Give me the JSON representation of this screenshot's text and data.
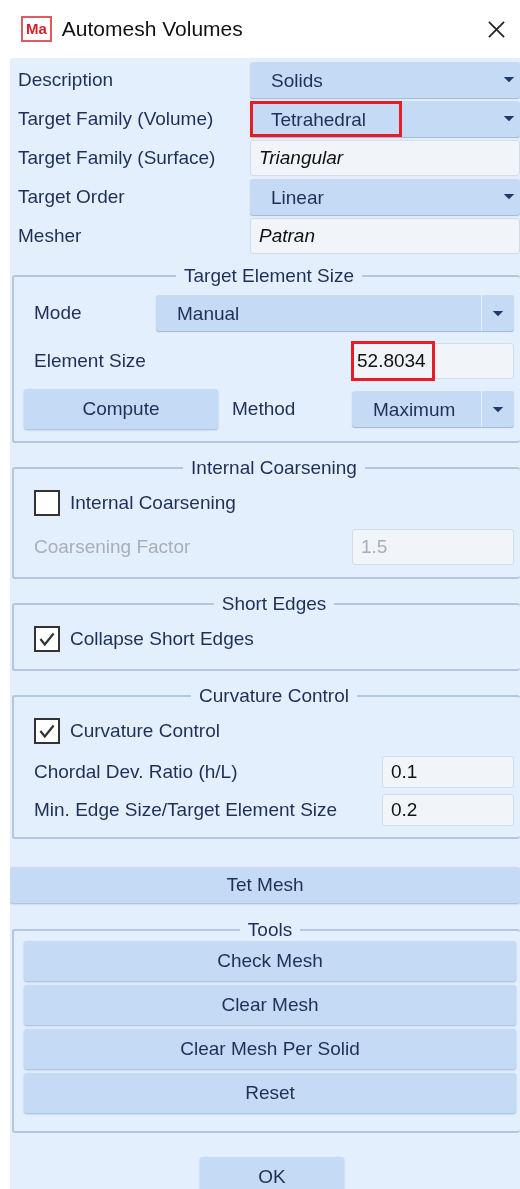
{
  "window": {
    "logo": "Ma",
    "title": "Automesh Volumes"
  },
  "properties": [
    {
      "label": "Description",
      "kind": "combo",
      "value": "Solids",
      "highlighted": false
    },
    {
      "label": "Target Family (Volume)",
      "kind": "combo",
      "value": "Tetrahedral",
      "highlighted": true
    },
    {
      "label": "Target Family (Surface)",
      "kind": "text",
      "value": "Triangular",
      "highlighted": false
    },
    {
      "label": "Target Order",
      "kind": "combo",
      "value": "Linear",
      "highlighted": false
    },
    {
      "label": "Mesher",
      "kind": "text",
      "value": "Patran",
      "highlighted": false
    }
  ],
  "target_element_size": {
    "title": "Target Element Size",
    "mode": {
      "label": "Mode",
      "value": "Manual"
    },
    "element_size": {
      "label": "Element Size",
      "value": "52.8034",
      "highlighted": true
    },
    "compute_button": "Compute",
    "method": {
      "label": "Method",
      "value": "Maximum"
    }
  },
  "internal_coarsening": {
    "title": "Internal Coarsening",
    "checkbox": {
      "label": "Internal Coarsening",
      "checked": false
    },
    "factor": {
      "label": "Coarsening Factor",
      "value": "1.5",
      "disabled": true
    }
  },
  "short_edges": {
    "title": "Short Edges",
    "checkbox": {
      "label": "Collapse Short Edges",
      "checked": true
    }
  },
  "curvature_control": {
    "title": "Curvature Control",
    "checkbox": {
      "label": "Curvature Control",
      "checked": true
    },
    "fields": [
      {
        "label": "Chordal Dev. Ratio (h/L)",
        "value": "0.1"
      },
      {
        "label": "Min. Edge Size/Target Element Size",
        "value": "0.2"
      }
    ]
  },
  "tet_mesh_button": "Tet Mesh",
  "tools": {
    "title": "Tools",
    "buttons": [
      "Check Mesh",
      "Clear Mesh",
      "Clear Mesh Per Solid",
      "Reset"
    ]
  },
  "ok_button": "OK"
}
